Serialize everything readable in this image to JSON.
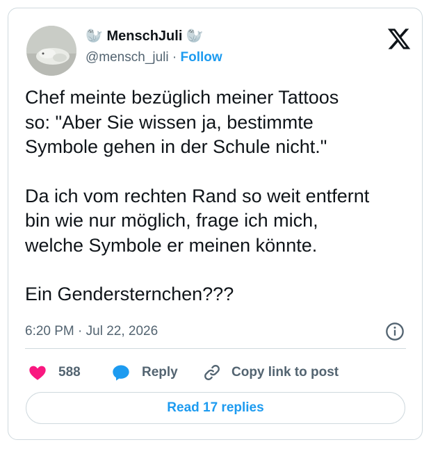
{
  "author": {
    "display_name": "🦭 MenschJuli 🦭",
    "handle": "@mensch_juli",
    "separator": " · ",
    "follow_label": "Follow"
  },
  "post": {
    "paragraphs": [
      "Chef meinte bezüglich meiner Tattoos\nso: \"Aber Sie wissen ja, bestimmte\nSymbole gehen in der Schule nicht.\"",
      "Da ich vom rechten Rand so weit entfernt\nbin wie nur möglich, frage ich mich,\nwelche Symbole er meinen könnte.",
      "Ein Gendersternchen???"
    ],
    "timestamp": "6:20 PM · Jul 22, 2026"
  },
  "actions": {
    "like_count": "588",
    "reply_label": "Reply",
    "copy_label": "Copy link to post",
    "read_replies_label": "Read 17 replies"
  },
  "colors": {
    "like": "#f91880",
    "reply": "#1d9bf0",
    "link": "#1d9bf0",
    "muted": "#536471",
    "border": "#cfd9de"
  },
  "icons": [
    "x-logo-icon",
    "info-icon",
    "heart-icon",
    "reply-bubble-icon",
    "link-icon"
  ]
}
